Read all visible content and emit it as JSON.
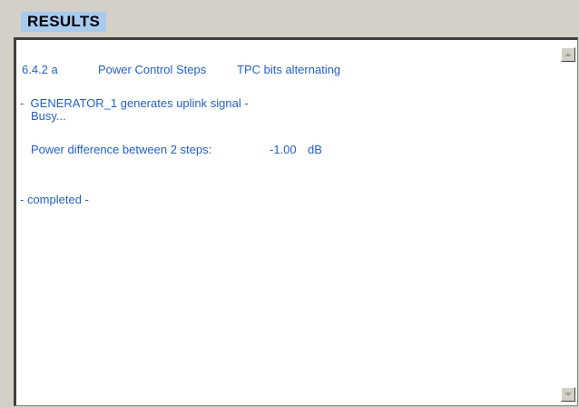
{
  "header": {
    "title": "RESULTS"
  },
  "results": {
    "test_id": "6.4.2 a",
    "test_name": "Power Control Steps",
    "test_condition": "TPC bits alternating",
    "generator_msg": "-  GENERATOR_1 generates uplink signal -",
    "busy_msg": "Busy...",
    "power_label": "Power difference between 2 steps:",
    "power_value": "-1.00",
    "power_unit": "dB",
    "completed_msg": "- completed -"
  },
  "scrollbar": {
    "up_icon": "scroll-up-arrow",
    "down_icon": "scroll-down-arrow"
  },
  "colors": {
    "text": "#1f5fd8",
    "header_bg": "#a6caf0",
    "window_bg": "#d4d0c8"
  }
}
